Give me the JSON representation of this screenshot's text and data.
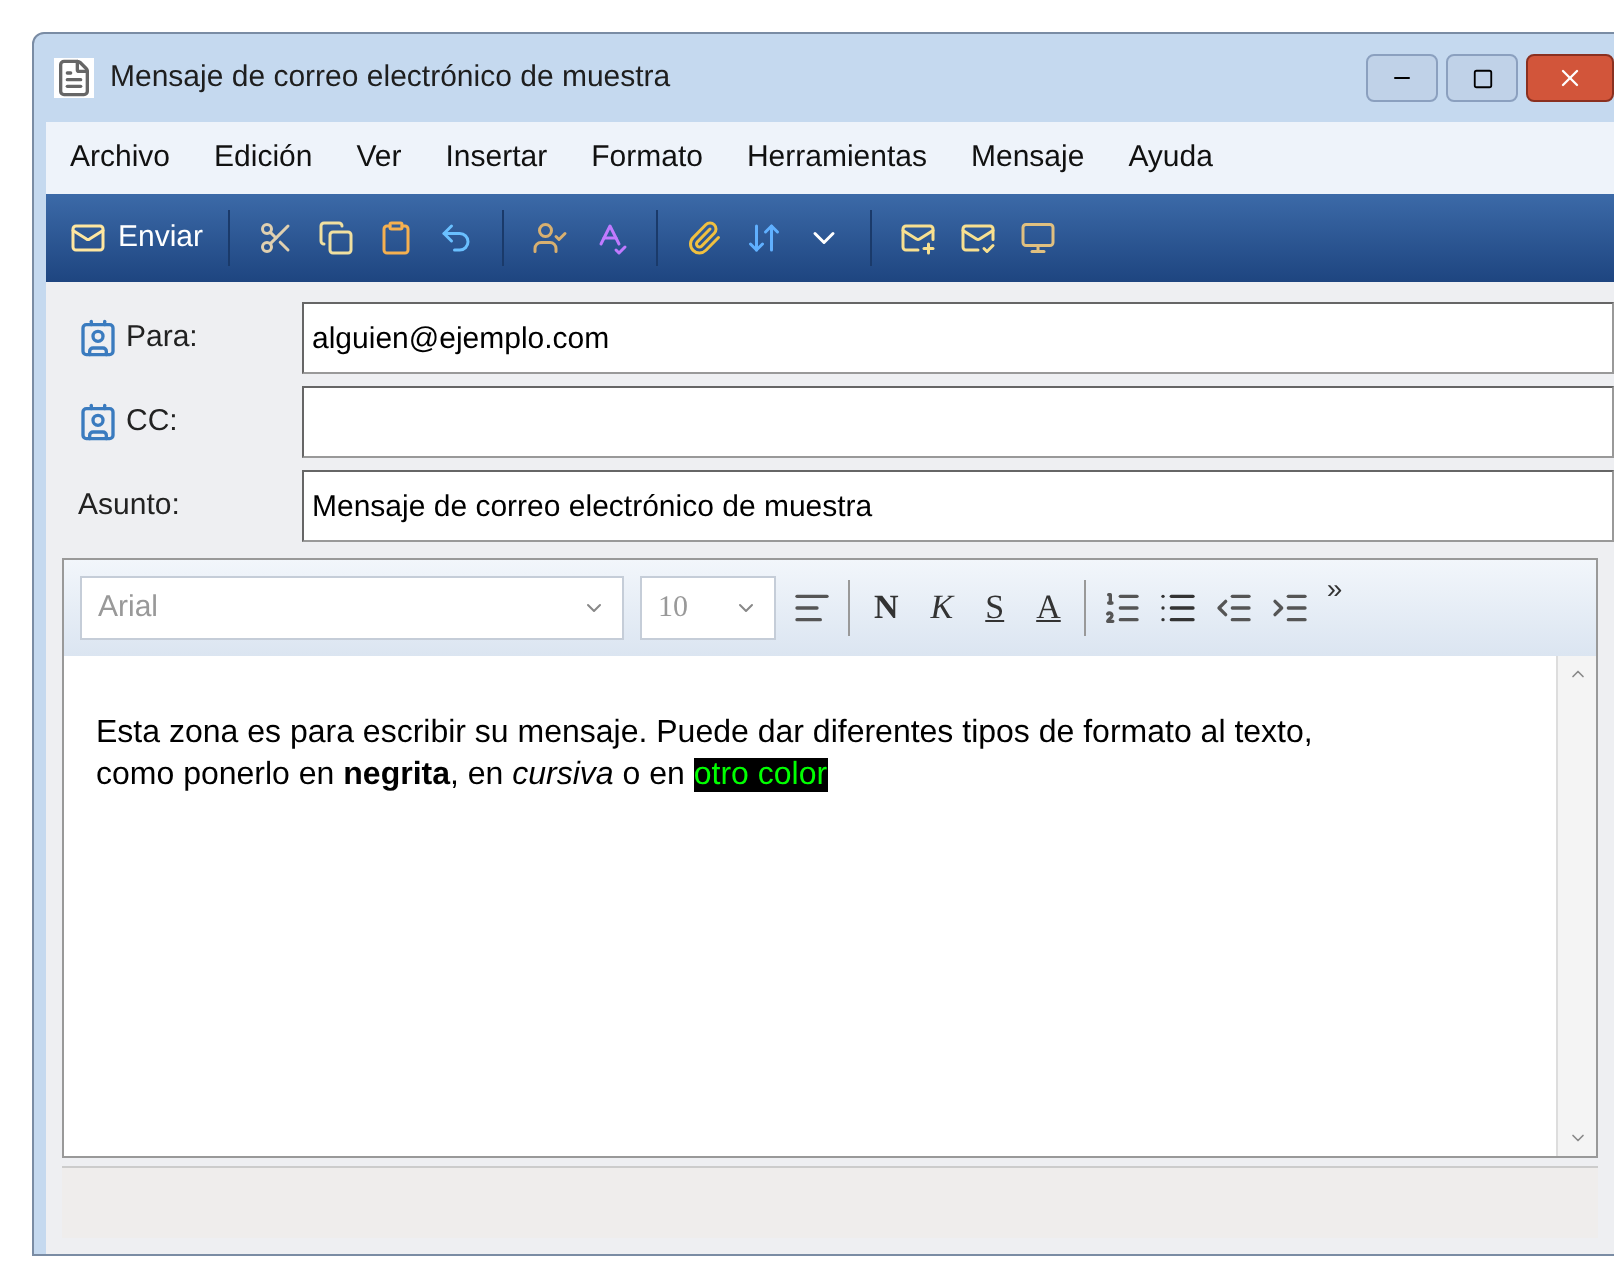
{
  "window": {
    "title": "Mensaje de correo electrónico de muestra"
  },
  "menu": [
    "Archivo",
    "Edición",
    "Ver",
    "Insertar",
    "Formato",
    "Herramientas",
    "Mensaje",
    "Ayuda"
  ],
  "toolbar": {
    "send_label": "Enviar"
  },
  "fields": [
    {
      "label": "Para:",
      "kind": "address",
      "value": "alguien@ejemplo.com"
    },
    {
      "label": "CC:",
      "kind": "address"
    },
    {
      "label": "Asunto:",
      "kind": "plain",
      "value": "Mensaje de correo electrónico de muestra"
    }
  ],
  "format_bar": {
    "font": "Arial",
    "size": "10",
    "disabled": true,
    "bold": "N",
    "italic": "K",
    "underline": "S",
    "font_color": "A",
    "more": "»"
  },
  "body": {
    "text": "Esta zona es para escribir su mensaje. Puede dar diferentes tipos de formato al texto, como ponerlo en **negrita**, en *cursiva* o en ",
    "highlight": {
      "text": "otro color",
      "color": "#000000"
    }
  }
}
